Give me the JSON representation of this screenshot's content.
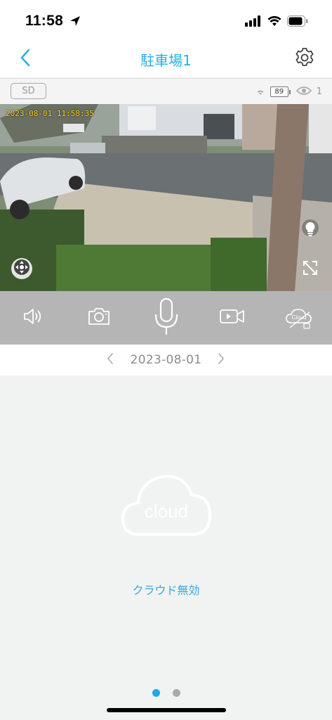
{
  "status_bar": {
    "time": "11:58",
    "icons": [
      "location-arrow-icon",
      "cellular-signal-icon",
      "wifi-icon",
      "battery-icon"
    ]
  },
  "nav": {
    "title": "駐車場1",
    "back_icon": "chevron-left-icon",
    "settings_icon": "gear-icon"
  },
  "info_strip": {
    "sd_label": "SD",
    "battery_level": "89",
    "viewer_count": "1",
    "icons": [
      "wifi-icon",
      "battery-icon",
      "eye-icon"
    ]
  },
  "video": {
    "timestamp": "2023-08-01  11:58:35",
    "overlay_icons": [
      "ptz-control-icon",
      "light-bulb-icon",
      "fullscreen-icon"
    ]
  },
  "controls": [
    {
      "name": "speaker-button",
      "icon": "speaker-icon"
    },
    {
      "name": "snapshot-button",
      "icon": "camera-icon"
    },
    {
      "name": "microphone-button",
      "icon": "microphone-icon"
    },
    {
      "name": "record-button",
      "icon": "video-camera-icon"
    },
    {
      "name": "cloud-button",
      "icon": "cloud-disabled-icon",
      "label": "Cloud"
    }
  ],
  "date_bar": {
    "date": "2023-08-01",
    "prev_icon": "chevron-left-icon",
    "next_icon": "chevron-right-icon"
  },
  "cloud_panel": {
    "icon_label": "cloud",
    "status": "クラウド無効"
  },
  "pagination": {
    "count": 2,
    "active_index": 0
  },
  "colors": {
    "accent": "#29aee6",
    "control_bar": "#b5b5b5",
    "timestamp": "#ffd21f",
    "panel_bg": "#f1f2f2"
  }
}
